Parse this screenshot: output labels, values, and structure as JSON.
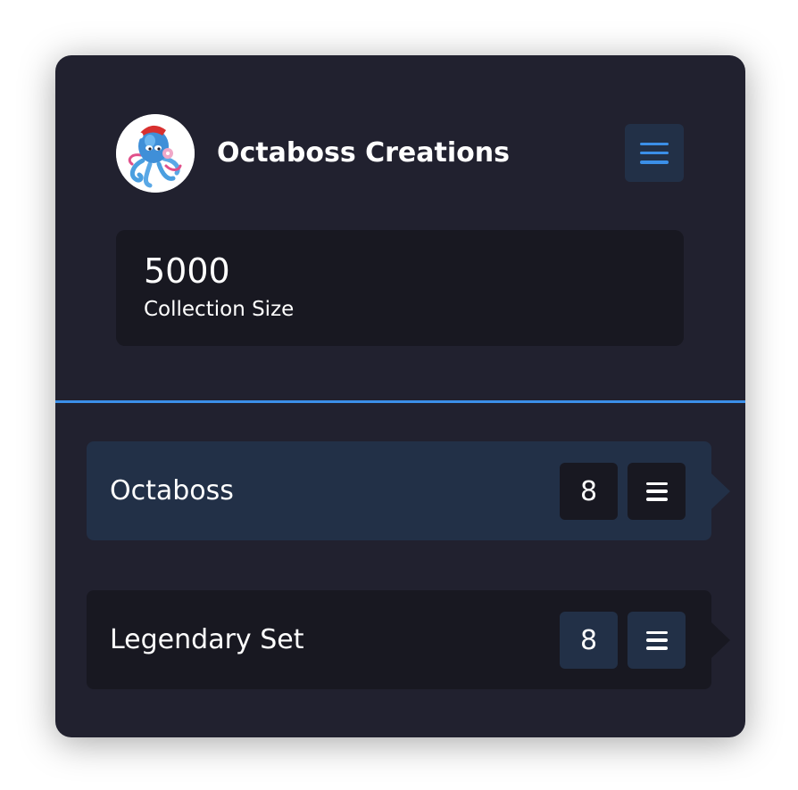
{
  "header": {
    "title": "Octaboss Creations",
    "avatar_icon": "octopus-mascot-icon",
    "menu_icon": "hamburger-menu-icon"
  },
  "stats": {
    "value": "5000",
    "label": "Collection Size"
  },
  "collections": [
    {
      "label": "Octaboss",
      "count": "8",
      "active": true,
      "action_icon": "list-icon"
    },
    {
      "label": "Legendary Set",
      "count": "8",
      "active": false,
      "action_icon": "list-icon"
    }
  ],
  "colors": {
    "card_bg": "#21212f",
    "panel_bg": "#181821",
    "active_bg": "#223047",
    "accent": "#3b8fe8",
    "text": "#ffffff"
  }
}
